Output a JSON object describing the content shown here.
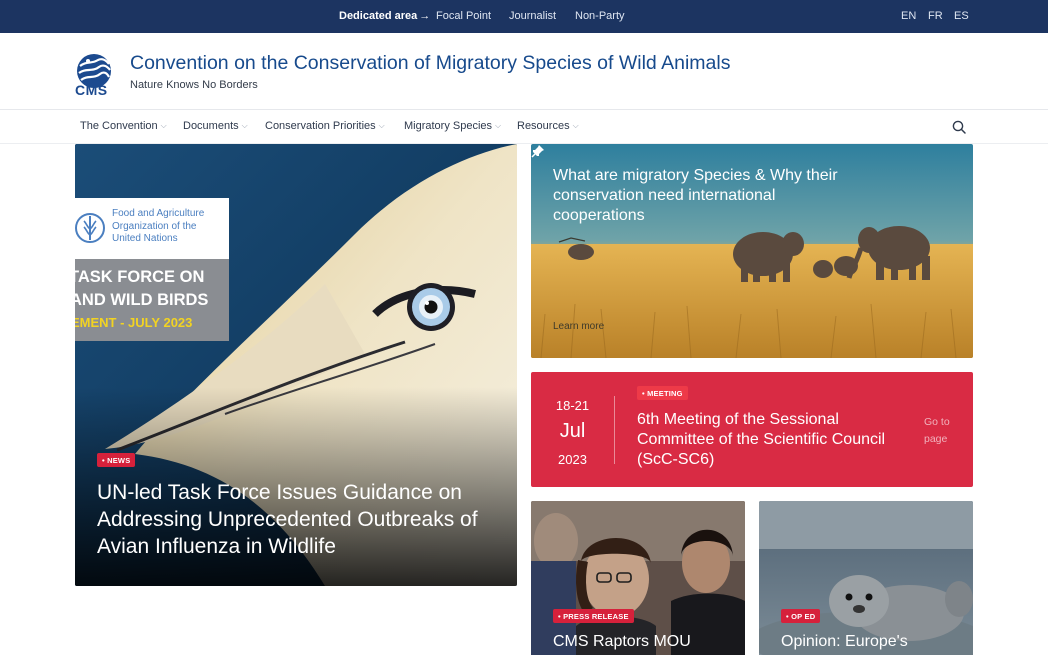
{
  "topbar": {
    "dedicated_label": "Dedicated area",
    "dedicated_arrow": "→",
    "links": [
      "Focal Point",
      "Journalist",
      "Non-Party"
    ],
    "languages": [
      "EN",
      "FR",
      "ES"
    ]
  },
  "header": {
    "logo_text": "CMS",
    "title": "Convention on the Conservation of Migratory Species of Wild Animals",
    "tagline": "Nature Knows No Borders"
  },
  "nav": {
    "items": [
      "The Convention",
      "Documents",
      "Conservation Priorities",
      "Migratory Species",
      "Resources"
    ],
    "chevron": "⌵",
    "search_icon": "search-icon"
  },
  "hero": {
    "fao_name": "Food and Agriculture\nOrganization of the\nUnited Nations",
    "fao_line1": "TASK FORCE ON",
    "fao_line2": "AND WILD BIRDS",
    "fao_line3": "EMENT - JULY 2023",
    "badge": "• NEWS",
    "title": "UN-led Task Force Issues Guidance on Addressing Unprecedented Outbreaks of Avian Influenza in Wildlife"
  },
  "feature": {
    "title": "What are migratory Species & Why their conservation need international cooperations",
    "link": "Learn more",
    "pin_icon": "pin-icon"
  },
  "meeting": {
    "date_range": "18-21",
    "month": "Jul",
    "year": "2023",
    "badge": "• MEETING",
    "title": "6th Meeting of the Sessional Committee of the Scientific Council (ScC-SC6)",
    "link": "Go to page"
  },
  "cards": [
    {
      "badge": "• PRESS RELEASE",
      "title": "CMS Raptors MOU"
    },
    {
      "badge": "• OP ED",
      "title": "Opinion: Europe's"
    }
  ],
  "colors": {
    "topbar": "#1c3461",
    "brand_blue": "#174a8c",
    "accent_red": "#d92b44",
    "badge_red": "#d6213b"
  }
}
